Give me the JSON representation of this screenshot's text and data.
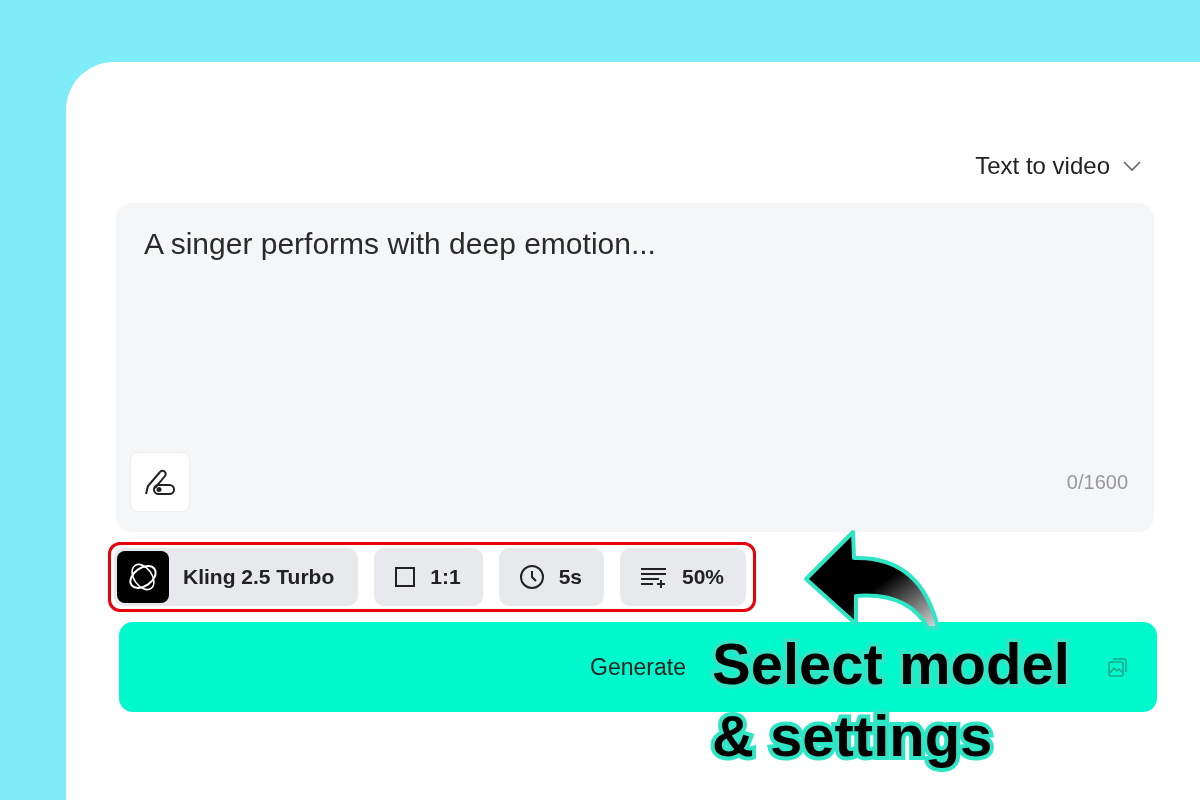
{
  "mode_selector": {
    "label": "Text to video"
  },
  "prompt": {
    "placeholder": "A singer performs with deep emotion...",
    "counter": "0/1600"
  },
  "settings_highlighted": true,
  "settings": [
    {
      "kind": "model",
      "label": "Kling 2.5 Turbo"
    },
    {
      "kind": "aspect",
      "label": "1:1"
    },
    {
      "kind": "duration",
      "label": "5s"
    },
    {
      "kind": "strength",
      "label": "50%"
    }
  ],
  "generate": {
    "label": "Generate"
  },
  "callout": {
    "lines": [
      "Select model",
      "& settings"
    ]
  }
}
